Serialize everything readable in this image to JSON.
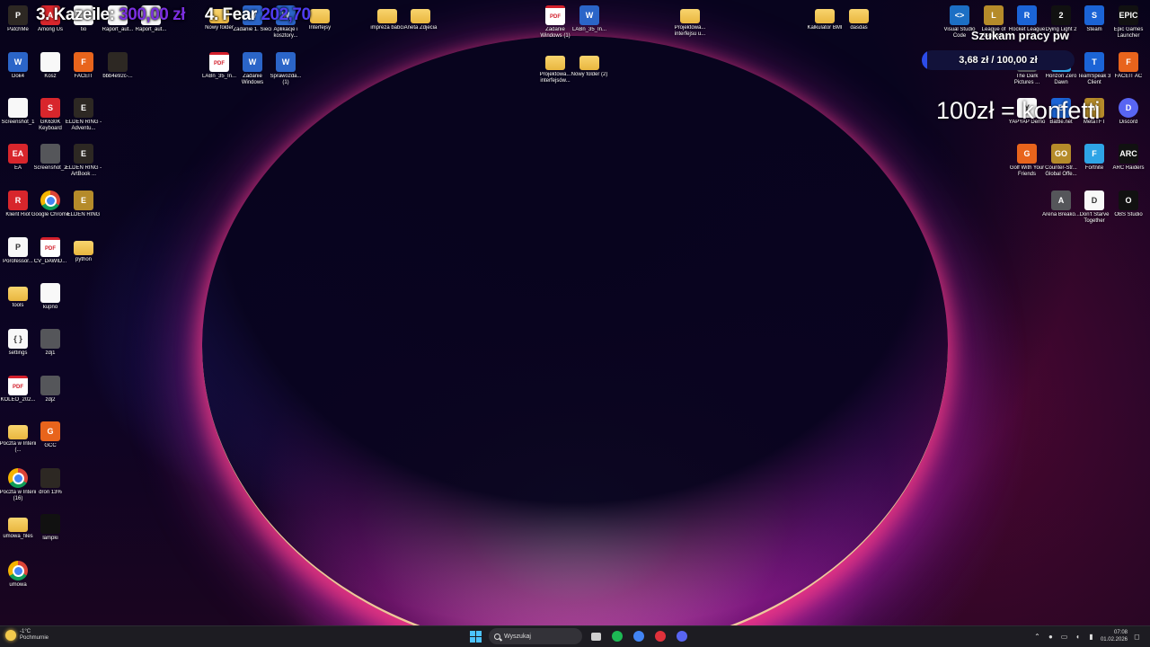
{
  "overlay": {
    "goal_left_1_label": "3. Kazeile:",
    "goal_left_1_amount": "300,00 zł",
    "goal_left_2_label": "4. Fear",
    "goal_left_2_amount": "202,70",
    "goal_title": "Szukam pracy pw",
    "goal_progress_text": "3,68 zł / 100,00 zł",
    "goal_progress_fraction": 0.0368,
    "goal_bar_color": "#2c4ce8",
    "konfetti_text": "100zł = konfetti"
  },
  "desktop_icons": [
    {
      "id": "patchme",
      "label": "PatchMe",
      "glyph": "P",
      "style": "ic-dark"
    },
    {
      "id": "among-us",
      "label": "Among Us",
      "glyph": "A",
      "style": "ic-red"
    },
    {
      "id": "tio",
      "label": "tio",
      "glyph": "",
      "style": "ic-white"
    },
    {
      "id": "raport-1",
      "label": "Raport_aut...",
      "glyph": "",
      "style": "ic-white"
    },
    {
      "id": "raport-2",
      "label": "Raport_aut...",
      "glyph": "",
      "style": "ic-white"
    },
    {
      "id": "nowy-folder",
      "label": "Nowy folder",
      "glyph": "",
      "style": "ic-folder"
    },
    {
      "id": "zadanie-1-sieci",
      "label": "Zadanie 1. Sieci",
      "glyph": "W",
      "style": "ic-word"
    },
    {
      "id": "aplikacje-koszt",
      "label": "Aplikacje i kosztory...",
      "glyph": "W",
      "style": "ic-word"
    },
    {
      "id": "interfejsy",
      "label": "Interfejsy",
      "glyph": "",
      "style": "ic-folder"
    },
    {
      "id": "impreza-babci",
      "label": "impreza babci",
      "glyph": "",
      "style": "ic-folder"
    },
    {
      "id": "aneta-zdjecia",
      "label": "Aneta Zdjecia",
      "glyph": "",
      "style": "ic-folder"
    },
    {
      "id": "zadanie-windows-1",
      "label": "Zadanie Windows (1)",
      "glyph": "PDF",
      "style": "ic-pdf"
    },
    {
      "id": "labn-35-in-top",
      "label": "LABn_35_In...",
      "glyph": "W",
      "style": "ic-word"
    },
    {
      "id": "projektowanie-u",
      "label": "Projektowa... interfejsu u...",
      "glyph": "",
      "style": "ic-folder"
    },
    {
      "id": "kalkulator-bmi",
      "label": "Kalkulator BMI",
      "glyph": "",
      "style": "ic-folder"
    },
    {
      "id": "dasdas",
      "label": "dasdas",
      "glyph": "",
      "style": "ic-folder"
    },
    {
      "id": "vscode",
      "label": "Visual Studio Code",
      "glyph": "<>",
      "style": "ic-vs"
    },
    {
      "id": "league",
      "label": "League of Legends",
      "glyph": "L",
      "style": "ic-gold"
    },
    {
      "id": "rocket-league",
      "label": "Rocket League",
      "glyph": "R",
      "style": "ic-blue"
    },
    {
      "id": "dying-light",
      "label": "Dying Light 2",
      "glyph": "2",
      "style": "ic-black"
    },
    {
      "id": "steam",
      "label": "Steam",
      "glyph": "S",
      "style": "ic-blue"
    },
    {
      "id": "epic",
      "label": "Epic Games Launcher",
      "glyph": "EPIC",
      "style": "ic-black"
    },
    {
      "id": "dok4",
      "label": "Dok4",
      "glyph": "W",
      "style": "ic-word"
    },
    {
      "id": "kosz",
      "label": "Kosz",
      "glyph": "",
      "style": "ic-white"
    },
    {
      "id": "faceit",
      "label": "FACEIT",
      "glyph": "F",
      "style": "ic-orange"
    },
    {
      "id": "bbb4e",
      "label": "bbb4e92c-...",
      "glyph": "",
      "style": "ic-dark"
    },
    {
      "id": "labn-35-in",
      "label": "LABn_35_In...",
      "glyph": "PDF",
      "style": "ic-pdf"
    },
    {
      "id": "zadanie-windows",
      "label": "Zadanie Windows",
      "glyph": "W",
      "style": "ic-word"
    },
    {
      "id": "sprawozdanie-1",
      "label": "Sprawozda... (1)",
      "glyph": "W",
      "style": "ic-word"
    },
    {
      "id": "projektowanie-interfejsow",
      "label": "Projektowa... interfejsów...",
      "glyph": "",
      "style": "ic-folder"
    },
    {
      "id": "nowy-folder-2",
      "label": "Nowy folder (2)",
      "glyph": "",
      "style": "ic-folder"
    },
    {
      "id": "dark-pictures",
      "label": "The Dark Pictures ...",
      "glyph": "D",
      "style": "ic-gray"
    },
    {
      "id": "horizon",
      "label": "Horizon Zero Dawn",
      "glyph": "H",
      "style": "ic-teal"
    },
    {
      "id": "teamspeak",
      "label": "TeamSpeak 3 Client",
      "glyph": "T",
      "style": "ic-blue"
    },
    {
      "id": "faceit-ac",
      "label": "FACEIT AC",
      "glyph": "F",
      "style": "ic-orange"
    },
    {
      "id": "screenshot-1",
      "label": "Screenshot_1",
      "glyph": "",
      "style": "ic-white"
    },
    {
      "id": "gk630k",
      "label": "GK630K Keyboard",
      "glyph": "S",
      "style": "ic-red"
    },
    {
      "id": "elden-adventure",
      "label": "ELDEN RING - Adventu...",
      "glyph": "E",
      "style": "ic-dark"
    },
    {
      "id": "yapyap",
      "label": "YAPYAP Demo",
      "glyph": "Y",
      "style": "ic-white"
    },
    {
      "id": "battlenet",
      "label": "Battle.net",
      "glyph": "B",
      "style": "ic-blue"
    },
    {
      "id": "metatft",
      "label": "MetaTFT",
      "glyph": "M",
      "style": "ic-gold"
    },
    {
      "id": "discord",
      "label": "Discord",
      "glyph": "D",
      "style": "ic-purple"
    },
    {
      "id": "ea",
      "label": "EA",
      "glyph": "EA",
      "style": "ic-red"
    },
    {
      "id": "screenshot-2",
      "label": "Screenshot_2",
      "glyph": "",
      "style": "ic-gray"
    },
    {
      "id": "elden-artbook",
      "label": "ELDEN RING - ArtBook ...",
      "glyph": "E",
      "style": "ic-dark"
    },
    {
      "id": "golf",
      "label": "Golf With Your Friends",
      "glyph": "G",
      "style": "ic-orange"
    },
    {
      "id": "csgo",
      "label": "Counter-Str... Global Offe...",
      "glyph": "GO",
      "style": "ic-gold"
    },
    {
      "id": "fortnite",
      "label": "Fortnite",
      "glyph": "F",
      "style": "ic-teal"
    },
    {
      "id": "arc-raiders",
      "label": "ARC Raiders",
      "glyph": "ARC",
      "style": "ic-black"
    },
    {
      "id": "klient-riot",
      "label": "Klient Riot",
      "glyph": "R",
      "style": "ic-red"
    },
    {
      "id": "chrome",
      "label": "Google Chrome",
      "glyph": "",
      "style": "ic-chrome"
    },
    {
      "id": "elden-ring",
      "label": "ELDEN RING",
      "glyph": "E",
      "style": "ic-gold"
    },
    {
      "id": "arena-breakout",
      "label": "Arena Breako...",
      "glyph": "A",
      "style": "ic-gray"
    },
    {
      "id": "dont-starve",
      "label": "Don't Starve Together",
      "glyph": "D",
      "style": "ic-white"
    },
    {
      "id": "obs",
      "label": "OBS Studio",
      "glyph": "O",
      "style": "ic-black"
    },
    {
      "id": "porofessor",
      "label": "Porofessor...",
      "glyph": "P",
      "style": "ic-white"
    },
    {
      "id": "cv-dawid",
      "label": "CV_DAWID...",
      "glyph": "PDF",
      "style": "ic-pdf"
    },
    {
      "id": "python",
      "label": "python",
      "glyph": "",
      "style": "ic-folder"
    },
    {
      "id": "tools",
      "label": "tools",
      "glyph": "",
      "style": "ic-folder"
    },
    {
      "id": "kupno",
      "label": "kupno",
      "glyph": "",
      "style": "ic-white"
    },
    {
      "id": "settings",
      "label": "settings",
      "glyph": "{ }",
      "style": "ic-white"
    },
    {
      "id": "zdj1",
      "label": "zdj1",
      "glyph": "",
      "style": "ic-gray"
    },
    {
      "id": "koleo",
      "label": "KOLEO_202...",
      "glyph": "PDF",
      "style": "ic-pdf"
    },
    {
      "id": "zdj2",
      "label": "zdj2",
      "glyph": "",
      "style": "ic-gray"
    },
    {
      "id": "poczta-interii",
      "label": "Poczta w Interii (...",
      "glyph": "",
      "style": "ic-folder"
    },
    {
      "id": "gcc",
      "label": "GCC",
      "glyph": "G",
      "style": "ic-orange"
    },
    {
      "id": "poczta-interii-16",
      "label": "Poczta w Interii (16)",
      "glyph": "",
      "style": "ic-chrome"
    },
    {
      "id": "dron",
      "label": "dron 13%",
      "glyph": "",
      "style": "ic-dark"
    },
    {
      "id": "umowa-files",
      "label": "umowa_files",
      "glyph": "",
      "style": "ic-folder"
    },
    {
      "id": "lampki",
      "label": "lampki",
      "glyph": "",
      "style": "ic-black"
    },
    {
      "id": "umowa",
      "label": "umowa",
      "glyph": "",
      "style": "ic-chrome"
    }
  ],
  "taskbar": {
    "weather_temp": "-1°C",
    "weather_desc": "Pochmurnie",
    "search_placeholder": "Wyszukaj",
    "time": "07:08",
    "date": "01.02.2026",
    "apps": [
      {
        "id": "task-view",
        "icon": "task-view-icon",
        "color": "#cfcfcf"
      },
      {
        "id": "spotify",
        "icon": "spotify-icon",
        "color": "#1db954"
      },
      {
        "id": "chrome",
        "icon": "chrome-icon",
        "color": "#4285f4"
      },
      {
        "id": "opera",
        "icon": "opera-icon",
        "color": "#e0313b"
      },
      {
        "id": "discord",
        "icon": "discord-icon",
        "color": "#5865f2"
      }
    ]
  }
}
